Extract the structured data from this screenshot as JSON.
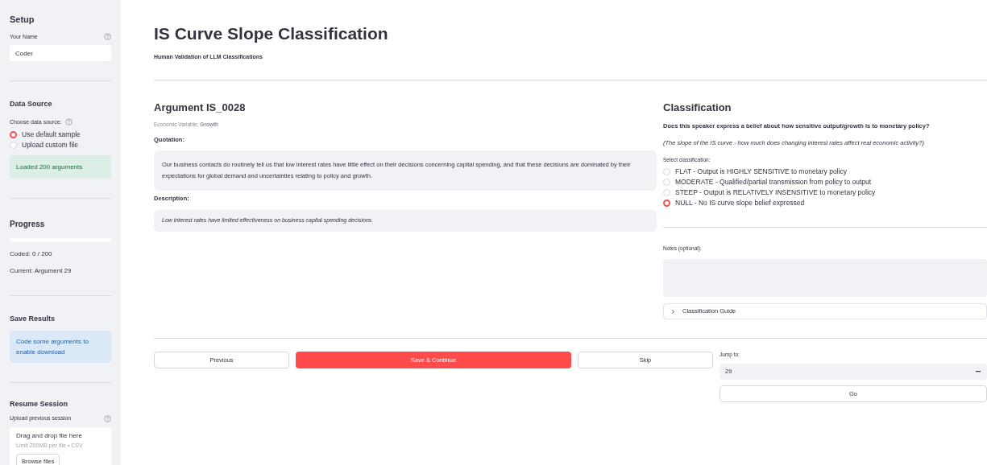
{
  "sidebar": {
    "setup": {
      "heading": "Setup",
      "name_label": "Your Name",
      "name_value": "Coder"
    },
    "data_source": {
      "heading": "Data Source",
      "label": "Choose data source:",
      "options": [
        {
          "label": "Use default sample",
          "selected": true
        },
        {
          "label": "Upload custom file",
          "selected": false
        }
      ],
      "status": "Loaded 200 arguments"
    },
    "progress": {
      "heading": "Progress",
      "level": 0,
      "coded": "Coded: 0 / 200",
      "current": "Current: Argument 29"
    },
    "save_results": {
      "heading": "Save Results",
      "info": "Code some arguments to enable download"
    },
    "resume": {
      "heading": "Resume Session",
      "label": "Upload previous session",
      "dropzone_text": "Drag and drop file here",
      "limit": "Limit 200MB per file • CSV",
      "browse_button": "Browse files"
    }
  },
  "header": {
    "title": "IS Curve Slope Classification",
    "subtitle": "Human Validation of LLM Classifications"
  },
  "argument": {
    "heading": "Argument IS_0028",
    "variable": "Economic Variable: **Growth**",
    "quotation_label": "Quotation:",
    "quotation": "Our business contacts do routinely tell us that low interest rates have little effect on their decisions concerning capital spending, and that these decisions are dominated by their expectations for global demand and uncertainties relating to policy and growth.",
    "description_label": "Description:",
    "description": "Low interest rates have limited effectiveness on business capital spending decisions"
  },
  "classification": {
    "heading": "Classification",
    "question": "Does this speaker express a belief about how sensitive output/growth is to monetary policy?",
    "hint": "(The slope of the IS curve - how much does changing interest rates affect real economic activity?)",
    "select_label": "Select classification:",
    "options": [
      {
        "label": "FLAT - Output is HIGHLY SENSITIVE to monetary policy",
        "selected": false
      },
      {
        "label": "MODERATE - Qualified/partial transmission from policy to output",
        "selected": false
      },
      {
        "label": "STEEP - Output is RELATIVELY INSENSITIVE to monetary policy",
        "selected": false
      },
      {
        "label": "NULL - No IS curve slope belief expressed",
        "selected": true
      }
    ],
    "notes_label": "Notes (optional):",
    "guide": {
      "label": "Classification Guide",
      "expanded": false
    }
  },
  "navigation": {
    "previous": "Previous",
    "save": "Save & Continue",
    "skip": "Skip",
    "jump_label": "Jump to:",
    "jump_value": "29",
    "go": "Go"
  }
}
